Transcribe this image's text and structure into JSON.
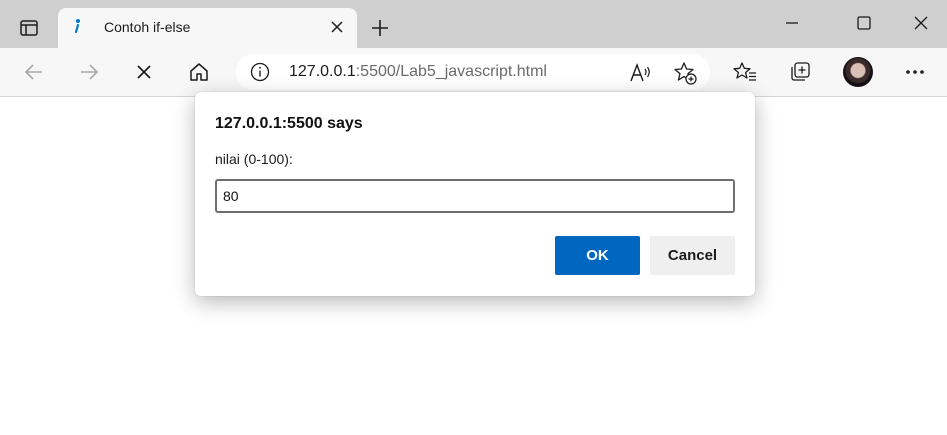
{
  "window": {
    "tab_title": "Contoh if-else",
    "controls": [
      "minimize-icon",
      "maximize-icon",
      "close-icon"
    ]
  },
  "toolbar": {
    "icons": [
      "back-icon",
      "forward-icon",
      "stop-icon",
      "home-icon",
      "info-icon",
      "read-aloud-icon",
      "add-favorite-icon",
      "favorites-icon",
      "collections-icon",
      "profile-avatar",
      "more-icon"
    ],
    "url_host": "127.0.0.1",
    "url_rest": ":5500/Lab5_javascript.html"
  },
  "dialog": {
    "title": "127.0.0.1:5500 says",
    "message": "nilai (0-100):",
    "input_value": "80",
    "ok_label": "OK",
    "cancel_label": "Cancel"
  },
  "colors": {
    "accent": "#0067c0",
    "tabstrip": "#cfcfcf",
    "toolbar": "#f7f7f7"
  }
}
